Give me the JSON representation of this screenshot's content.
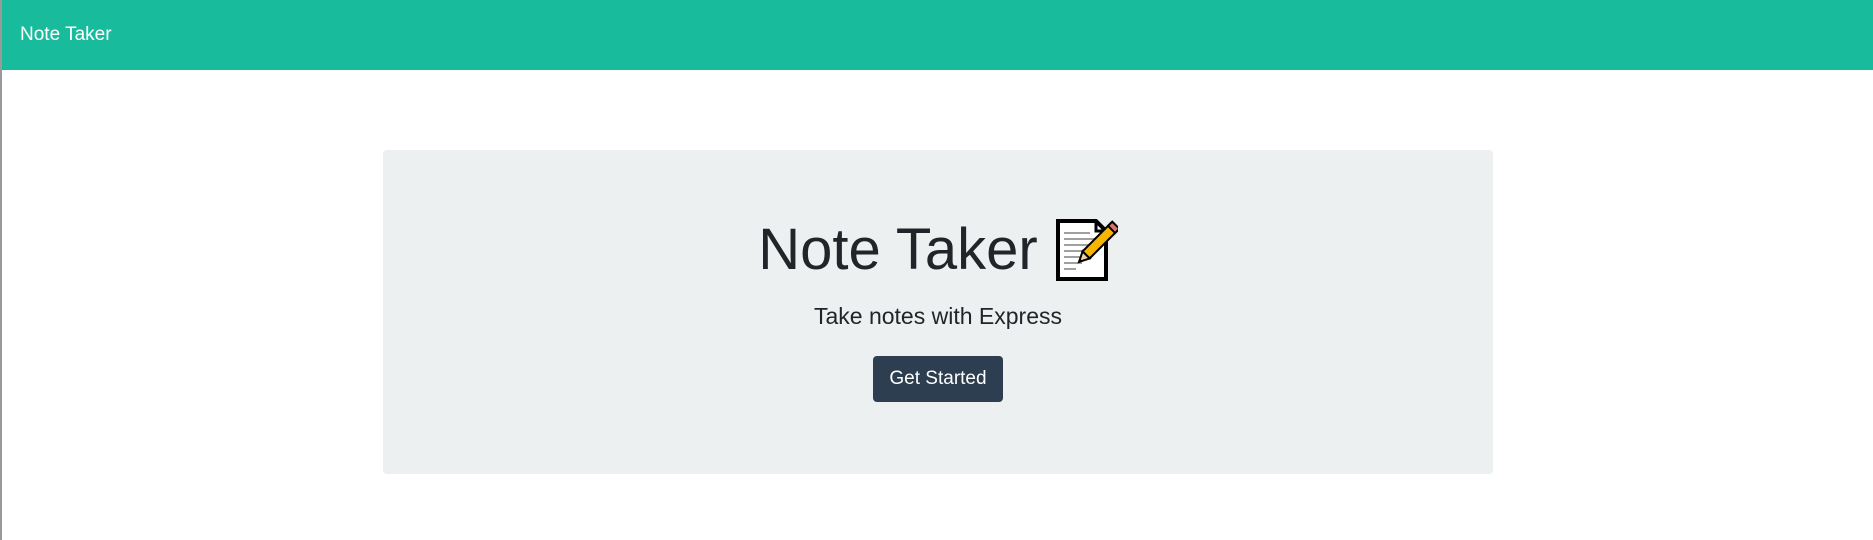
{
  "navbar": {
    "brand": "Note Taker",
    "color": "#18bc9c"
  },
  "hero": {
    "title": "Note Taker",
    "icon": "memo-pencil-icon",
    "subtitle": "Take notes with Express",
    "button_label": "Get Started",
    "button_color": "#2c3e50",
    "background_color": "#ecf0f1"
  }
}
